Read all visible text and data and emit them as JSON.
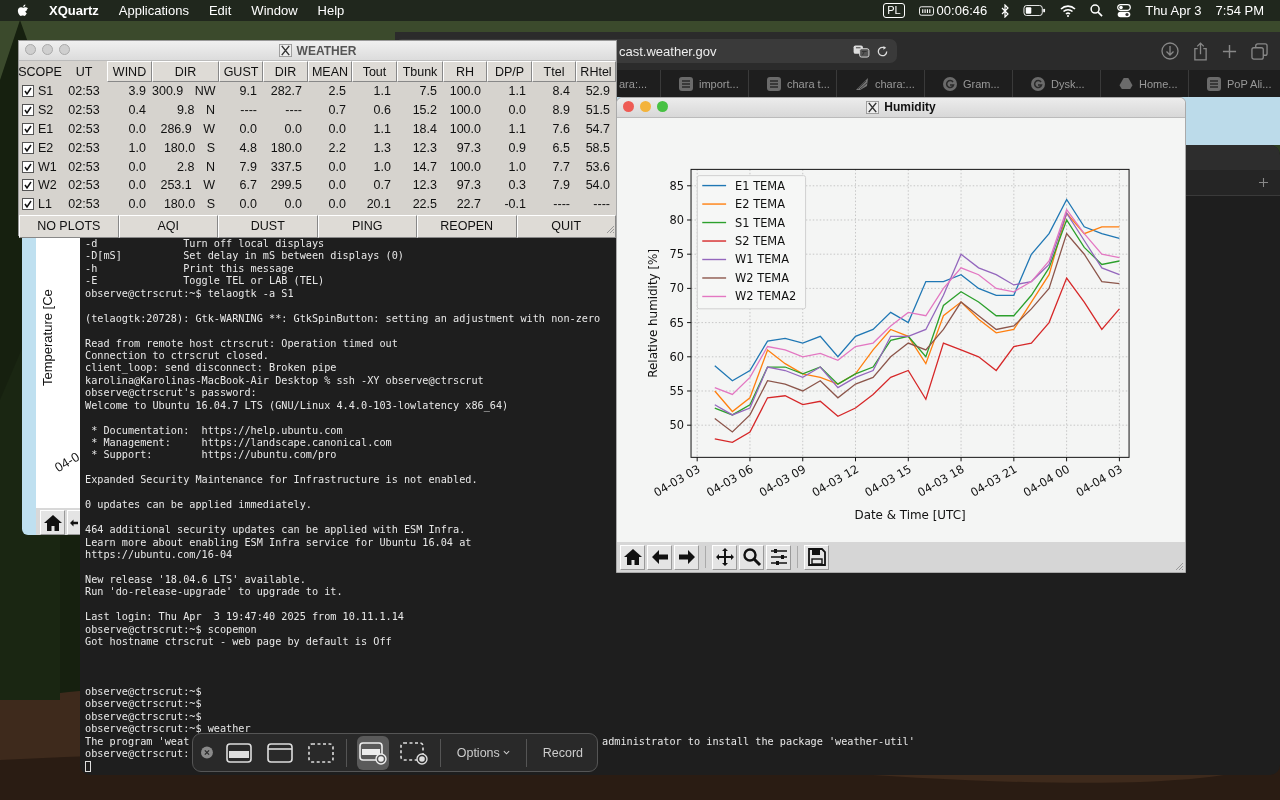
{
  "menu_bar": {
    "app_name": "XQuartz",
    "menus": [
      "Applications",
      "Edit",
      "Window",
      "Help"
    ],
    "input_source": "PL",
    "timer": "00:06:46",
    "date": "Thu Apr 3",
    "time": "7:54 PM"
  },
  "browser": {
    "url": "cast.weather.gov",
    "tabs": [
      {
        "title": "ara:...",
        "kind": "none"
      },
      {
        "title": "import...",
        "kind": "doc"
      },
      {
        "title": "chara t...",
        "kind": "doc"
      },
      {
        "title": "chara:...",
        "kind": "leaf"
      },
      {
        "title": "Gram...",
        "kind": "ring"
      },
      {
        "title": "Dysk...",
        "kind": "ring"
      },
      {
        "title": "Home...",
        "kind": "triangle"
      },
      {
        "title": "PoP Ali...",
        "kind": "doc"
      }
    ]
  },
  "temperature_window": {
    "ylabel": "Temperature [Ce",
    "xtick": "04-0"
  },
  "terminal": {
    "lines": [
      {
        "kind": "text",
        "text": "-d              Turn off local displays"
      },
      {
        "kind": "text",
        "text": "-D[mS]          Set delay in mS between displays (0)"
      },
      {
        "kind": "text",
        "text": "-h              Print this message"
      },
      {
        "kind": "text",
        "text": "-E              Toggle TEL or LAB (TEL)"
      },
      {
        "kind": "text",
        "text": "observe@ctrscrut:~$ telaogtk -a S1"
      },
      {
        "kind": "blank"
      },
      {
        "kind": "text",
        "text": "(telaogtk:20728): Gtk-WARNING **: GtkSpinButton: setting an adjustment with non-zero"
      },
      {
        "kind": "blank"
      },
      {
        "kind": "text",
        "text": "Read from remote host ctrscrut: Operation timed out"
      },
      {
        "kind": "text",
        "text": "Connection to ctrscrut closed."
      },
      {
        "kind": "text",
        "text": "client_loop: send disconnect: Broken pipe"
      },
      {
        "kind": "text",
        "text": "karolina@Karolinas-MacBook-Air Desktop % ssh -XY observe@ctrscrut"
      },
      {
        "kind": "text",
        "text": "observe@ctrscrut's password:"
      },
      {
        "kind": "text",
        "text": "Welcome to Ubuntu 16.04.7 LTS (GNU/Linux 4.4.0-103-lowlatency x86_64)"
      },
      {
        "kind": "blank"
      },
      {
        "kind": "text",
        "text": " * Documentation:  https://help.ubuntu.com"
      },
      {
        "kind": "text",
        "text": " * Management:     https://landscape.canonical.com"
      },
      {
        "kind": "text",
        "text": " * Support:        https://ubuntu.com/pro"
      },
      {
        "kind": "blank"
      },
      {
        "kind": "text",
        "text": "Expanded Security Maintenance for Infrastructure is not enabled."
      },
      {
        "kind": "blank"
      },
      {
        "kind": "text",
        "text": "0 updates can be applied immediately."
      },
      {
        "kind": "blank"
      },
      {
        "kind": "text",
        "text": "464 additional security updates can be applied with ESM Infra."
      },
      {
        "kind": "text",
        "text": "Learn more about enabling ESM Infra service for Ubuntu 16.04 at"
      },
      {
        "kind": "text",
        "text": "https://ubuntu.com/16-04"
      },
      {
        "kind": "blank"
      },
      {
        "kind": "text",
        "text": "New release '18.04.6 LTS' available."
      },
      {
        "kind": "text",
        "text": "Run 'do-release-upgrade' to upgrade to it."
      },
      {
        "kind": "blank"
      },
      {
        "kind": "text",
        "text": "Last login: Thu Apr  3 19:47:40 2025 from 10.11.1.14"
      },
      {
        "kind": "text",
        "text": "observe@ctrscrut:~$ scopemon"
      },
      {
        "kind": "text",
        "text": "Got hostname ctrscrut - web page by default is Off"
      },
      {
        "kind": "blank"
      },
      {
        "kind": "blank"
      },
      {
        "kind": "blank"
      },
      {
        "kind": "text",
        "text": "observe@ctrscrut:~$"
      },
      {
        "kind": "text",
        "text": "observe@ctrscrut:~$"
      },
      {
        "kind": "text",
        "text": "observe@ctrscrut:~$"
      },
      {
        "kind": "text",
        "text": "observe@ctrscrut:~$ weather"
      },
      {
        "kind": "split",
        "left": "The program 'weat",
        "right": "administrator to install the package 'weather-util'"
      },
      {
        "kind": "text",
        "text": "observe@ctrscrut:"
      },
      {
        "kind": "cursor"
      }
    ]
  },
  "weather_window": {
    "title": "WEATHER",
    "columns": [
      {
        "label": "SCOPE",
        "kind": "label"
      },
      {
        "label": "UT",
        "kind": "label"
      },
      {
        "label": "WIND",
        "kind": "button"
      },
      {
        "label": "DIR",
        "kind": "button"
      },
      {
        "label": "GUST",
        "kind": "button"
      },
      {
        "label": "DIR",
        "kind": "button"
      },
      {
        "label": "MEAN",
        "kind": "button"
      },
      {
        "label": "Tout",
        "kind": "button"
      },
      {
        "label": "Tbunk",
        "kind": "button"
      },
      {
        "label": "RH",
        "kind": "button"
      },
      {
        "label": "DP/P",
        "kind": "button"
      },
      {
        "label": "Ttel",
        "kind": "button"
      },
      {
        "label": "RHtel",
        "kind": "button"
      }
    ],
    "rows": [
      {
        "checked": true,
        "cells": [
          "S1",
          "02:53",
          "3.9",
          "300.9 NW",
          "9.1",
          "282.7",
          "2.5",
          "1.1",
          "7.5",
          "100.0",
          "1.1",
          "8.4",
          "52.9"
        ]
      },
      {
        "checked": true,
        "cells": [
          "S2",
          "02:53",
          "0.4",
          "9.8 N",
          "----",
          "----",
          "0.7",
          "0.6",
          "15.2",
          "100.0",
          "0.0",
          "8.9",
          "51.5"
        ]
      },
      {
        "checked": true,
        "cells": [
          "E1",
          "02:53",
          "0.0",
          "286.9 W",
          "0.0",
          "0.0",
          "0.0",
          "1.1",
          "18.4",
          "100.0",
          "1.1",
          "7.6",
          "54.7"
        ]
      },
      {
        "checked": true,
        "cells": [
          "E2",
          "02:53",
          "1.0",
          "180.0 S",
          "4.8",
          "180.0",
          "2.2",
          "1.3",
          "12.3",
          "97.3",
          "0.9",
          "6.5",
          "58.5"
        ]
      },
      {
        "checked": true,
        "cells": [
          "W1",
          "02:53",
          "0.0",
          "2.8 N",
          "7.9",
          "337.5",
          "0.0",
          "1.0",
          "14.7",
          "100.0",
          "1.0",
          "7.7",
          "53.6"
        ]
      },
      {
        "checked": true,
        "cells": [
          "W2",
          "02:53",
          "0.0",
          "253.1 W",
          "6.7",
          "299.5",
          "0.0",
          "0.7",
          "12.3",
          "97.3",
          "0.3",
          "7.9",
          "54.0"
        ]
      },
      {
        "checked": true,
        "cells": [
          "L1",
          "02:53",
          "0.0",
          "180.0 S",
          "0.0",
          "0.0",
          "0.0",
          "20.1",
          "22.5",
          "22.7",
          "-0.1",
          "----",
          "----"
        ]
      }
    ],
    "buttons": [
      "NO PLOTS",
      "AQI",
      "DUST",
      "PING",
      "REOPEN",
      "QUIT"
    ]
  },
  "humidity_window": {
    "title": "Humidity",
    "chart_data": {
      "type": "line",
      "xlabel": "Date & Time [UTC]",
      "ylabel": "Relative humidity [%]",
      "categories": [
        "04-03 03",
        null,
        null,
        "04-03 06",
        null,
        null,
        "04-03 09",
        null,
        null,
        "04-03 12",
        null,
        null,
        "04-03 15",
        null,
        null,
        "04-03 18",
        null,
        null,
        "04-03 21",
        null,
        null,
        "04-04 00",
        null,
        null,
        "04-04 03"
      ],
      "ylim": [
        45.3,
        87.4
      ],
      "grid": true,
      "legend": "upper left",
      "yticks": [
        50,
        55,
        60,
        65,
        70,
        75,
        80,
        85
      ],
      "series": [
        {
          "name": "E1 TEMA",
          "color": "#1f77b4",
          "values": [
            null,
            58.7,
            56.5,
            58,
            62.3,
            62.7,
            62,
            63,
            60,
            63,
            64,
            66.5,
            65,
            71,
            71,
            72,
            70,
            69,
            69,
            75,
            78,
            83,
            79,
            78,
            77.3
          ]
        },
        {
          "name": "E2 TEMA",
          "color": "#ff7f0e",
          "values": [
            null,
            55,
            52,
            54,
            61,
            59,
            57.5,
            57,
            56,
            57.5,
            61,
            64,
            63,
            59,
            66,
            68,
            65.5,
            63.5,
            64,
            68,
            72,
            81,
            78,
            79,
            79
          ]
        },
        {
          "name": "S1 TEMA",
          "color": "#2ca02c",
          "values": [
            null,
            52.5,
            51.5,
            53,
            58.5,
            58.5,
            57.5,
            58.5,
            56,
            57.5,
            58.5,
            62.4,
            63,
            60,
            67.5,
            69.5,
            68,
            66,
            66,
            69,
            73,
            80,
            76,
            73.5,
            74
          ]
        },
        {
          "name": "S2 TEMA",
          "color": "#d62728",
          "values": [
            null,
            48,
            47.5,
            49,
            54,
            54.3,
            53,
            53.5,
            51.3,
            52.5,
            54.5,
            57,
            58,
            53.8,
            62,
            61,
            60,
            58,
            61.5,
            62,
            65,
            71.5,
            68,
            64,
            67
          ]
        },
        {
          "name": "W1 TEMA",
          "color": "#9467bd",
          "values": [
            null,
            53,
            51.5,
            52.5,
            58.5,
            58,
            57,
            58.5,
            55.5,
            57,
            58,
            63,
            63,
            64,
            69,
            75,
            73,
            72,
            70.5,
            71,
            73.5,
            81,
            77,
            73,
            72
          ]
        },
        {
          "name": "W2 TEMA",
          "color": "#8c564b",
          "values": [
            null,
            51,
            49,
            51.5,
            56.5,
            56,
            55,
            56.5,
            54,
            56,
            57,
            60,
            62,
            61,
            64,
            68,
            66,
            64,
            64.5,
            67,
            70,
            78,
            75,
            71,
            70.7
          ]
        },
        {
          "name": "W2 TEMA2",
          "color": "#e377c2",
          "values": [
            null,
            55.5,
            54.5,
            57,
            61.5,
            61,
            60,
            60.5,
            59.5,
            61.5,
            62,
            64.5,
            66.5,
            66,
            70,
            73,
            72,
            70,
            69.5,
            71,
            74,
            81.5,
            78,
            75,
            74.5
          ]
        }
      ]
    }
  },
  "screenshot_toolbar": {
    "modes": [
      {
        "kind": "capture-screen",
        "selected": false
      },
      {
        "kind": "capture-window",
        "selected": false
      },
      {
        "kind": "capture-selection",
        "selected": false
      },
      {
        "kind": "record-screen",
        "selected": true
      },
      {
        "kind": "record-selection",
        "selected": false
      }
    ],
    "options": "Options",
    "record": "Record"
  }
}
